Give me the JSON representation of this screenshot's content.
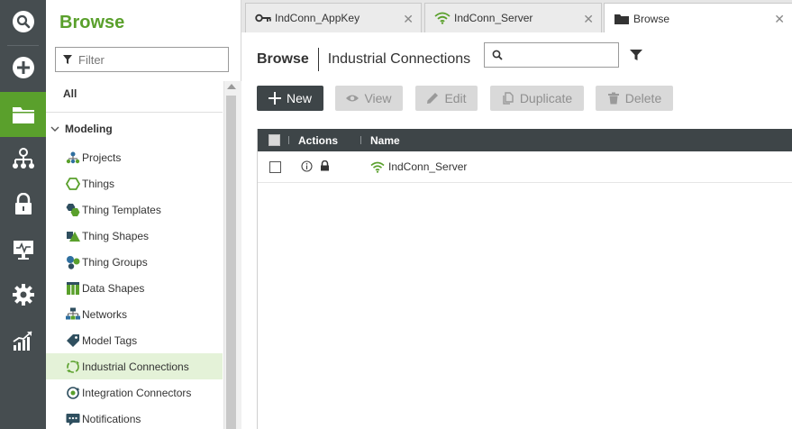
{
  "rail": {
    "items": [
      {
        "icon": "search-icon"
      },
      {
        "icon": "plus-circle-icon"
      },
      {
        "icon": "folder-icon",
        "active": true
      },
      {
        "icon": "hierarchy-icon"
      },
      {
        "icon": "lock-icon"
      },
      {
        "icon": "monitor-icon"
      },
      {
        "icon": "gear-icon"
      },
      {
        "icon": "analytics-icon"
      }
    ]
  },
  "sidebar": {
    "title": "Browse",
    "filter_placeholder": "Filter",
    "all_label": "All",
    "group_label": "Modeling",
    "items": [
      {
        "label": "Projects",
        "icon": "projects-icon"
      },
      {
        "label": "Things",
        "icon": "things-icon"
      },
      {
        "label": "Thing Templates",
        "icon": "thing-templates-icon"
      },
      {
        "label": "Thing Shapes",
        "icon": "thing-shapes-icon"
      },
      {
        "label": "Thing Groups",
        "icon": "thing-groups-icon"
      },
      {
        "label": "Data Shapes",
        "icon": "data-shapes-icon"
      },
      {
        "label": "Networks",
        "icon": "networks-icon"
      },
      {
        "label": "Model Tags",
        "icon": "model-tags-icon"
      },
      {
        "label": "Industrial Connections",
        "icon": "industrial-connections-icon",
        "selected": true
      },
      {
        "label": "Integration Connectors",
        "icon": "integration-connectors-icon"
      },
      {
        "label": "Notifications",
        "icon": "notifications-icon"
      }
    ]
  },
  "tabs": [
    {
      "label": "IndConn_AppKey",
      "icon": "key-icon"
    },
    {
      "label": "IndConn_Server",
      "icon": "wifi-icon"
    },
    {
      "label": "Browse",
      "icon": "folder-icon",
      "active": true
    }
  ],
  "breadcrumb": {
    "root": "Browse",
    "current": "Industrial Connections"
  },
  "search": {
    "placeholder": "",
    "value": ""
  },
  "toolbar": {
    "new_label": "New",
    "view_label": "View",
    "edit_label": "Edit",
    "duplicate_label": "Duplicate",
    "delete_label": "Delete"
  },
  "grid": {
    "columns": [
      "Actions",
      "Name"
    ],
    "rows": [
      {
        "name": "IndConn_Server"
      }
    ]
  },
  "colors": {
    "accent": "#5aa02c",
    "rail": "#464d50",
    "header": "#3e4548"
  }
}
